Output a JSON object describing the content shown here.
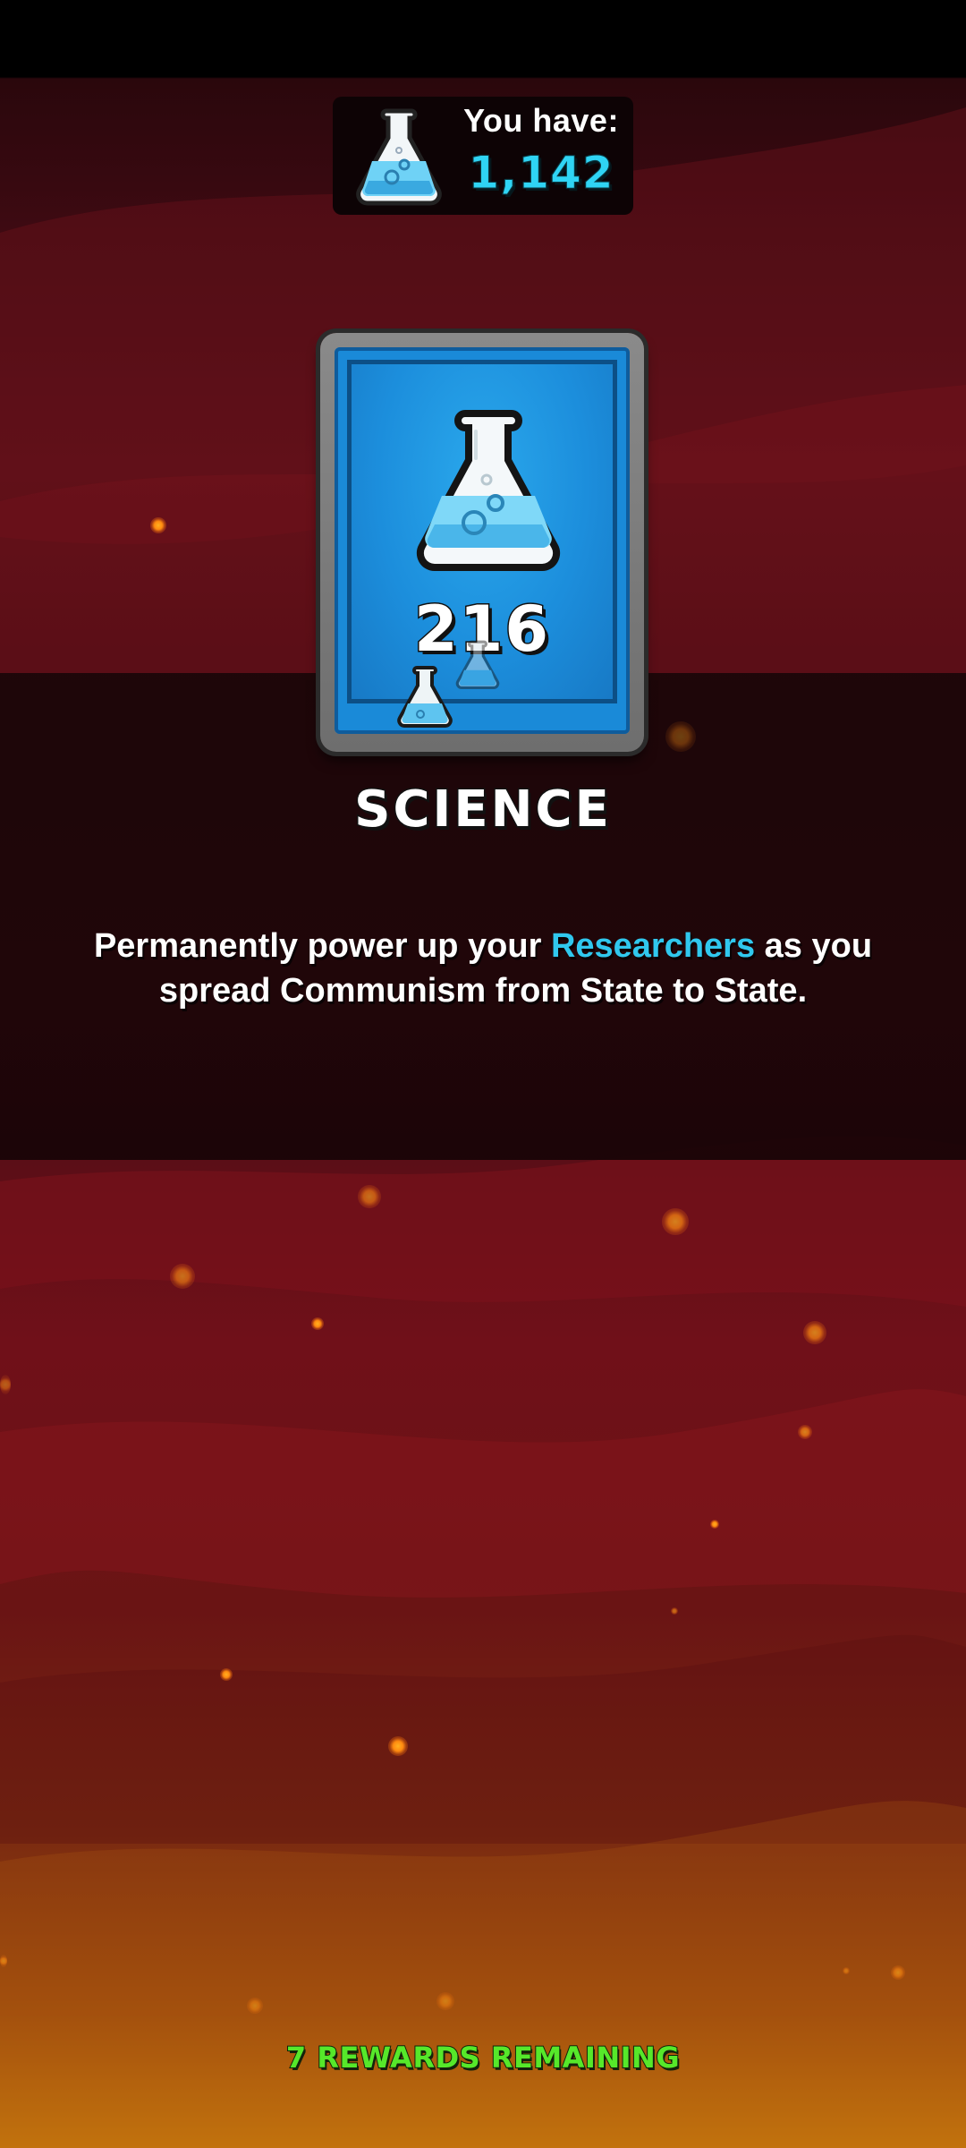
{
  "currency": {
    "label": "You have:",
    "value": "1,142",
    "icon": "flask-icon"
  },
  "reward_card": {
    "count": "216",
    "title": "SCIENCE",
    "icon": "flask-icon"
  },
  "description": {
    "before": "Permanently power up your ",
    "highlight": "Researchers",
    "after": " as you spread Communism from State to State."
  },
  "footer": {
    "rewards_remaining": "7 REWARDS REMAINING"
  },
  "colors": {
    "accent_cyan": "#30c8ee",
    "rewards_green": "#56e82a",
    "card_blue": "#1a8ad8"
  }
}
